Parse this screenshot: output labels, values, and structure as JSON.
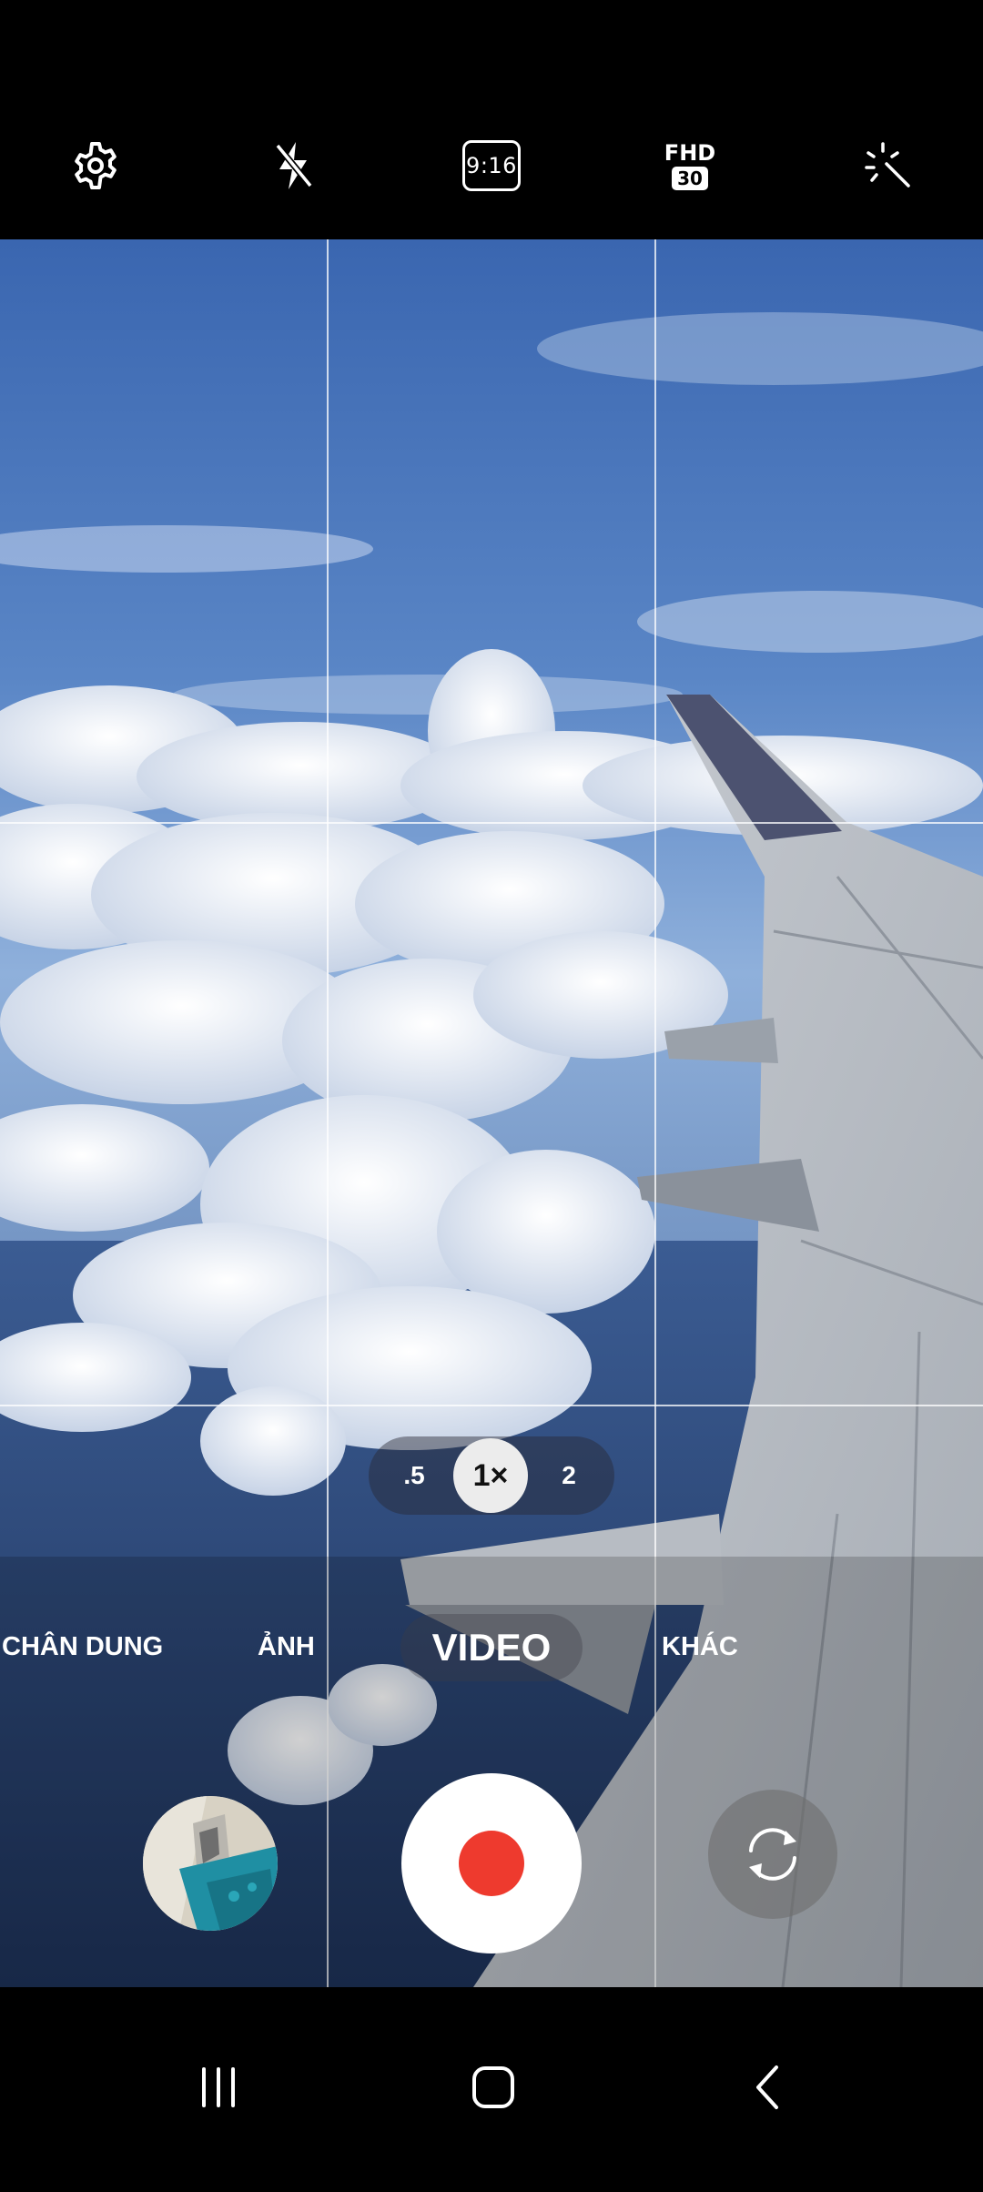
{
  "top_bar": {
    "settings_icon": "gear-icon",
    "flash_icon": "flash-off-icon",
    "aspect_ratio_label": "9:16",
    "quality_label": "FHD",
    "quality_fps": "30",
    "effects_icon": "magic-wand-icon"
  },
  "zoom": {
    "options": [
      ".5",
      "1×",
      "2"
    ],
    "selected": "1×"
  },
  "modes": {
    "portrait": "CHÂN DUNG",
    "photo": "ẢNH",
    "video": "VIDEO",
    "more": "KHÁC",
    "active": "VIDEO"
  },
  "controls": {
    "gallery_icon": "gallery-thumbnail",
    "record_icon": "record-icon",
    "switch_camera_icon": "switch-camera-icon"
  },
  "nav": {
    "recents_icon": "recents-icon",
    "home_icon": "home-icon",
    "back_icon": "back-icon"
  },
  "colors": {
    "record_red": "#ee3a2e",
    "sky_blue": "#3f6fb8"
  }
}
